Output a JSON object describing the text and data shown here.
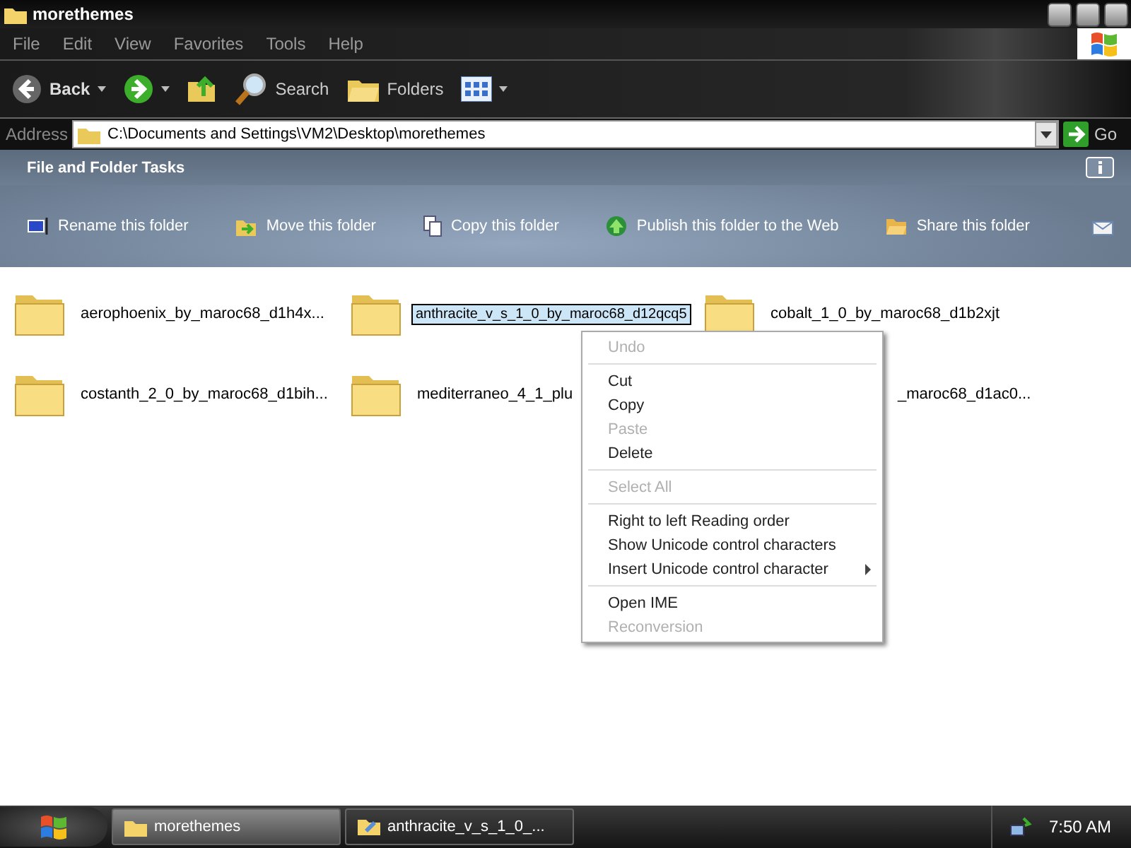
{
  "window": {
    "title": "morethemes"
  },
  "menu_bar": [
    "File",
    "Edit",
    "View",
    "Favorites",
    "Tools",
    "Help"
  ],
  "toolbar": [
    {
      "kind": "back",
      "label": "Back",
      "disabled": true
    },
    {
      "kind": "forward",
      "disabled": false
    },
    {
      "kind": "up"
    },
    {
      "kind": "search",
      "label": "Search"
    },
    {
      "kind": "folders",
      "label": "Folders"
    },
    {
      "kind": "views"
    }
  ],
  "address": {
    "label": "Address",
    "value": "C:\\Documents and Settings\\VM2\\Desktop\\morethemes",
    "go": "Go"
  },
  "task_pane": {
    "title": "File and Folder Tasks",
    "tasks": [
      {
        "kind": "rename",
        "label": "Rename this folder"
      },
      {
        "kind": "move",
        "label": "Move this folder"
      },
      {
        "kind": "copy",
        "label": "Copy this folder"
      },
      {
        "kind": "publish",
        "label": "Publish this folder to the Web"
      },
      {
        "kind": "share",
        "label": "Share this folder"
      },
      {
        "kind": "email"
      }
    ]
  },
  "folders": [
    {
      "kind": "normal",
      "name": "aerophoenix_by_maroc68_d1h4x..."
    },
    {
      "kind": "renaming",
      "name": "anthracite_v_s_1_0_by_maroc68_d12qcq5"
    },
    {
      "kind": "normal",
      "name": "cobalt_1_0_by_maroc68_d1b2xjt"
    },
    {
      "kind": "normal",
      "name": "costanth_2_0_by_maroc68_d1bih..."
    },
    {
      "kind": "normal",
      "name": "mediterraneo_4_1_plu"
    },
    {
      "kind": "covered",
      "name": "_maroc68_d1ac0..."
    }
  ],
  "context_menu": [
    {
      "kind": "item",
      "label": "Undo",
      "disabled": true
    },
    {
      "kind": "separator"
    },
    {
      "kind": "item",
      "label": "Cut",
      "disabled": false
    },
    {
      "kind": "item",
      "label": "Copy",
      "disabled": false
    },
    {
      "kind": "item",
      "label": "Paste",
      "disabled": true
    },
    {
      "kind": "item",
      "label": "Delete",
      "disabled": false
    },
    {
      "kind": "separator"
    },
    {
      "kind": "item",
      "label": "Select All",
      "disabled": true
    },
    {
      "kind": "separator"
    },
    {
      "kind": "item",
      "label": "Right to left Reading order",
      "disabled": false
    },
    {
      "kind": "item",
      "label": "Show Unicode control characters",
      "disabled": false
    },
    {
      "kind": "submenu",
      "label": "Insert Unicode control character",
      "disabled": false
    },
    {
      "kind": "separator"
    },
    {
      "kind": "item",
      "label": "Open IME",
      "disabled": false
    },
    {
      "kind": "item",
      "label": "Reconversion",
      "disabled": true
    }
  ],
  "taskbar": {
    "buttons": [
      {
        "kind": "folder",
        "label": "morethemes",
        "selected": true
      },
      {
        "kind": "edit",
        "label": "anthracite_v_s_1_0_...",
        "selected": false
      }
    ],
    "clock": "7:50 AM"
  }
}
